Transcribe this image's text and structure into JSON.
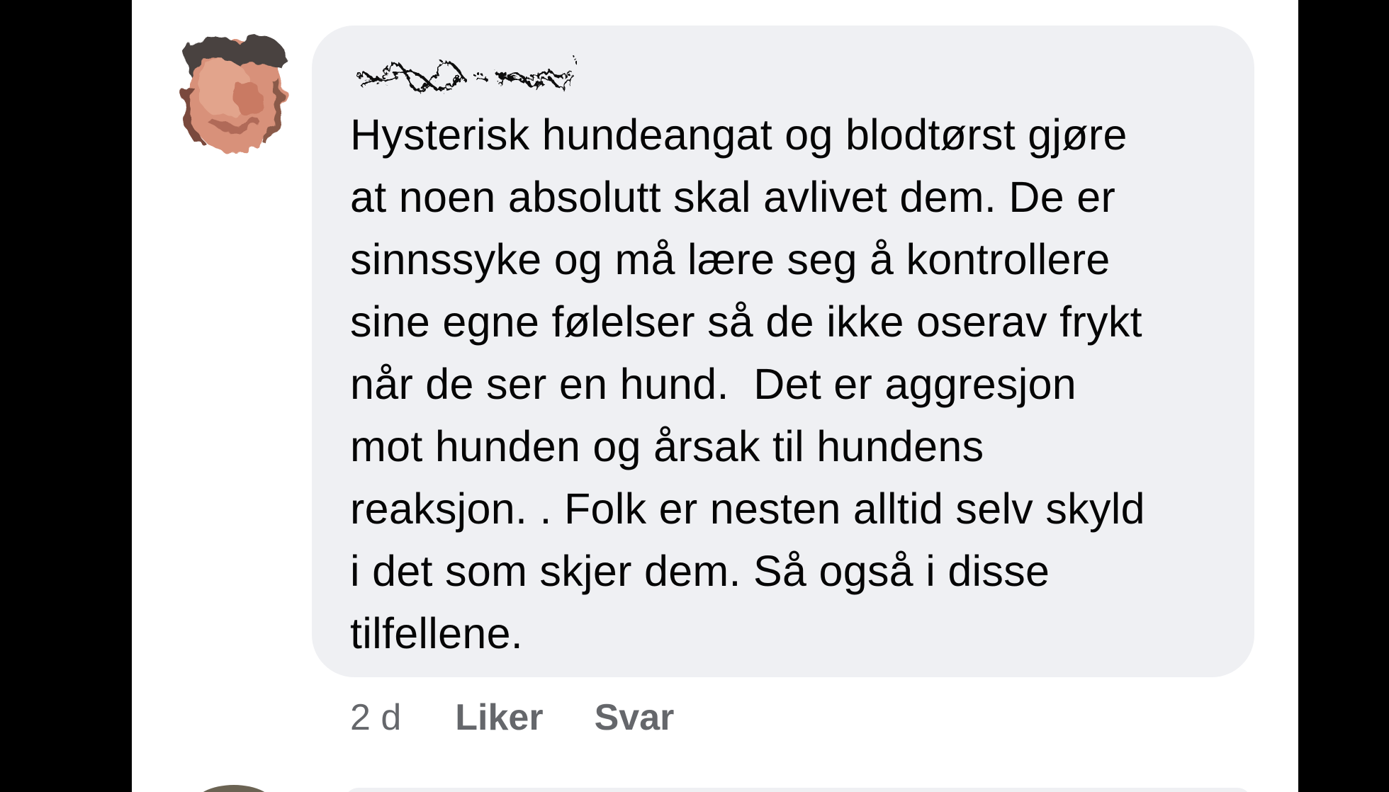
{
  "comment": {
    "author_redacted": true,
    "text": "Hysterisk hundeangat og blodtørst gjøre\nat noen absolutt skal avlivet dem. De er\nsinnssyke og må lære seg å kontrollere\nsine egne følelser så de ikke oserav frykt\nnår de ser en hund.  Det er aggresjon\nmot hunden og årsak til hundens\nreaksjon. . Folk er nesten alltid selv skyld\ni det som skjer dem. Så også i disse\ntilfellene.",
    "timestamp": "2 d",
    "like_label": "Liker",
    "reply_label": "Svar"
  },
  "colors": {
    "background_outer": "#000000",
    "page_background": "#ffffff",
    "bubble_background": "#eff0f3",
    "text_primary": "#050505",
    "text_secondary": "#65676b"
  },
  "icons": {
    "avatar": "avatar-distorted-icon",
    "author_name": "redacted-name-scribble"
  }
}
